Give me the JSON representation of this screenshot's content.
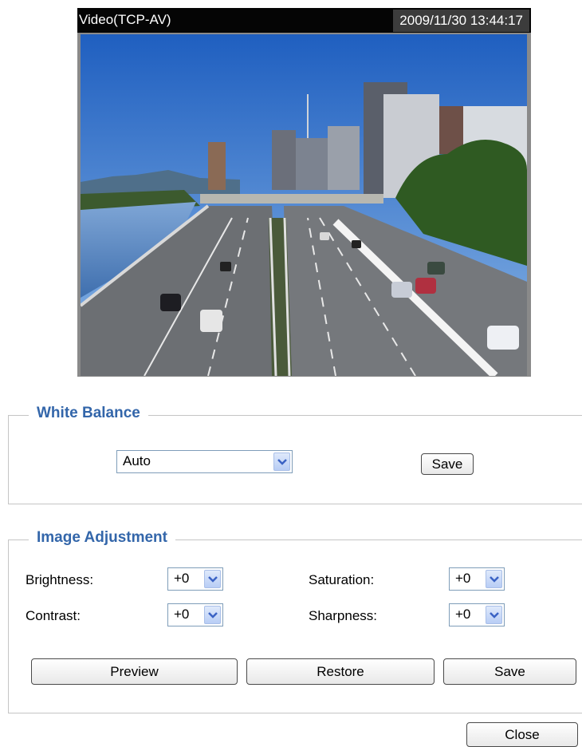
{
  "video": {
    "title": "Video(TCP-AV)",
    "timestamp": "2009/11/30 13:44:17"
  },
  "white_balance": {
    "legend": "White Balance",
    "mode_value": "Auto",
    "save_label": "Save"
  },
  "image_adjustment": {
    "legend": "Image Adjustment",
    "brightness_label": "Brightness:",
    "brightness_value": "+0",
    "contrast_label": "Contrast:",
    "contrast_value": "+0",
    "saturation_label": "Saturation:",
    "saturation_value": "+0",
    "sharpness_label": "Sharpness:",
    "sharpness_value": "+0",
    "preview_label": "Preview",
    "restore_label": "Restore",
    "save_label": "Save"
  },
  "close_label": "Close",
  "colors": {
    "legend_text": "#3366aa",
    "fieldset_border": "#c5c5c5",
    "dropdown_arrow": "#3b63c4"
  }
}
